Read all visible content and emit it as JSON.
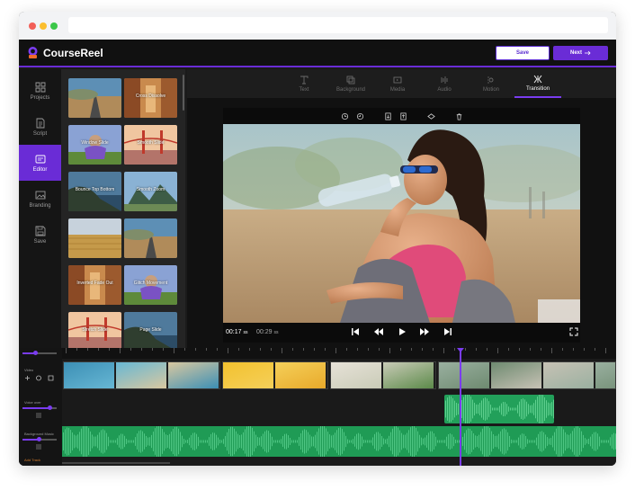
{
  "app": {
    "name": "CourseReel",
    "brand_color": "#6a2cd6"
  },
  "header": {
    "save_label": "Save",
    "next_label": "Next"
  },
  "sidebar": {
    "items": [
      {
        "label": "Projects",
        "icon": "grid-icon",
        "active": false
      },
      {
        "label": "Script",
        "icon": "document-icon",
        "active": false
      },
      {
        "label": "Editor",
        "icon": "editor-icon",
        "active": true
      },
      {
        "label": "Branding",
        "icon": "image-icon",
        "active": false
      },
      {
        "label": "Save",
        "icon": "floppy-icon",
        "active": false
      }
    ]
  },
  "thumbnails": [
    {
      "label": "",
      "scene": "road"
    },
    {
      "label": "Cross Dissolve",
      "scene": "alley"
    },
    {
      "label": "Window Slide",
      "scene": "woman"
    },
    {
      "label": "Smooth Slide",
      "scene": "bridge"
    },
    {
      "label": "Bounce Top Bottom",
      "scene": "cliff"
    },
    {
      "label": "Smooth Zoom",
      "scene": "mountains"
    },
    {
      "label": "",
      "scene": "wheat"
    },
    {
      "label": "",
      "scene": "road"
    },
    {
      "label": "Inverted Fade Out",
      "scene": "alley"
    },
    {
      "label": "Glitch Movement",
      "scene": "woman"
    },
    {
      "label": "Stretch Slide",
      "scene": "bridge"
    },
    {
      "label": "Page Slide",
      "scene": "cliff"
    }
  ],
  "tabs": [
    {
      "label": "Text",
      "icon": "text-icon",
      "active": false
    },
    {
      "label": "Background",
      "icon": "layers-icon",
      "active": false
    },
    {
      "label": "Media",
      "icon": "media-icon",
      "active": false
    },
    {
      "label": "Audio",
      "icon": "audio-icon",
      "active": false
    },
    {
      "label": "Motion",
      "icon": "motion-icon",
      "active": false
    },
    {
      "label": "Transition",
      "icon": "transition-icon",
      "active": true
    }
  ],
  "preview_toolbar": [
    "rotate-left-icon",
    "rotate-right-icon",
    "bring-front-icon",
    "send-back-icon",
    "flip-icon",
    "delete-icon"
  ],
  "player": {
    "current_time": "00:17",
    "current_suffix": "ss",
    "total_time": "00:29",
    "total_suffix": "ss"
  },
  "timeline": {
    "video_label": "Video",
    "voice_label": "Voice over",
    "music_label": "Background Music",
    "add_label": "Add Track",
    "playhead_fraction": 0.715
  }
}
